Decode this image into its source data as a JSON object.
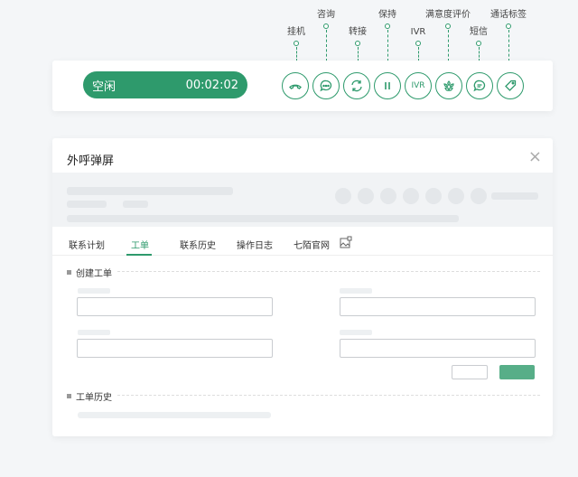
{
  "callouts": {
    "hangup": "挂机",
    "consult": "咨询",
    "transfer": "转接",
    "hold": "保持",
    "ivr": "IVR",
    "satisfaction": "满意度评价",
    "sms": "短信",
    "call_tag": "通话标签"
  },
  "toolbar": {
    "status_text": "空闲",
    "timer": "00:02:02",
    "ivr_button_text": "IVR"
  },
  "popup": {
    "title": "外呼弹屏",
    "close": "×",
    "tabs": [
      "联系计划",
      "工单",
      "联系历史",
      "操作日志",
      "七陌官网"
    ],
    "active_tab": "工单",
    "section_create": "创建工单",
    "section_history": "工单历史"
  },
  "colors": {
    "accent": "#2e9a6c",
    "button_primary": "#57ae88"
  }
}
